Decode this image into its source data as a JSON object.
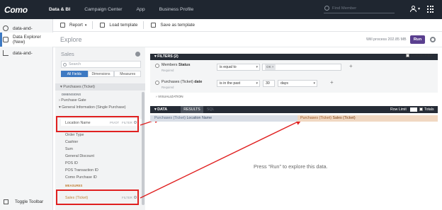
{
  "colors": {
    "topbar": "#1f2630",
    "accent": "#3d79c2",
    "run": "#5a3f8f",
    "measure": "#c07f33",
    "annotation": "#e02020"
  },
  "topnav": {
    "logo": "Como",
    "items": [
      "Data & BI",
      "Campaign Center",
      "App",
      "Business Profile"
    ],
    "search_placeholder": "Find Member"
  },
  "sidebar": {
    "items": [
      {
        "label": "data-and-",
        "icon": "globe-icon"
      },
      {
        "label": "Data Explorer (New)",
        "icon": "explore-icon"
      },
      {
        "label": "data-and-",
        "icon": "chart-icon"
      }
    ],
    "toggle_label": "Toggle Toolbar"
  },
  "toolbar": {
    "report": "Report",
    "load": "Load template",
    "save": "Save as template"
  },
  "explore": {
    "title": "Explore",
    "process_text": "Will process 202.85 MB",
    "run_label": "Run"
  },
  "field_panel": {
    "title": "Sales",
    "search_placeholder": "Search",
    "tabs": [
      "All Fields",
      "Dimensions",
      "Measures"
    ],
    "group": "Purchases (Ticket)",
    "dimensions_label": "DIMENSIONS",
    "gate": "Purchase Gate",
    "general_info": "General Information (Single Purchase)",
    "location_name": "Location Name",
    "pivot": "PIVOT",
    "filter": "FILTER",
    "fields": [
      "Order Type",
      "Cashier",
      "Sum",
      "General Discount",
      "POS ID",
      "POS Transaction ID",
      "Como Purchase ID"
    ],
    "measures_label": "MEASURES",
    "sales_ticket": "Sales (Ticket)"
  },
  "filters": {
    "header": "FILTERS (2)",
    "custom_filter": "Custom Filter",
    "rows": [
      {
        "field": "Members",
        "field_bold": "Status",
        "required": "Required",
        "operator": "is equal to",
        "value": "OK"
      },
      {
        "field": "Purchases (Ticket)",
        "field_bold": "date",
        "required": "Required",
        "operator": "is in the past",
        "value": "30",
        "unit": "days"
      }
    ]
  },
  "visualization_label": "VISUALIZATION",
  "data_section": {
    "label": "DATA",
    "tabs": [
      "RESULTS",
      "SQL"
    ],
    "row_limit": "Row Limit",
    "totals": "Totals",
    "dim_header_prefix": "Purchases (Ticket)",
    "dim_header": "Location Name",
    "meas_header_prefix": "Purchases (Ticket)",
    "meas_header": "Sales (Ticket)",
    "empty_message": "Press “Run” to explore this data."
  }
}
